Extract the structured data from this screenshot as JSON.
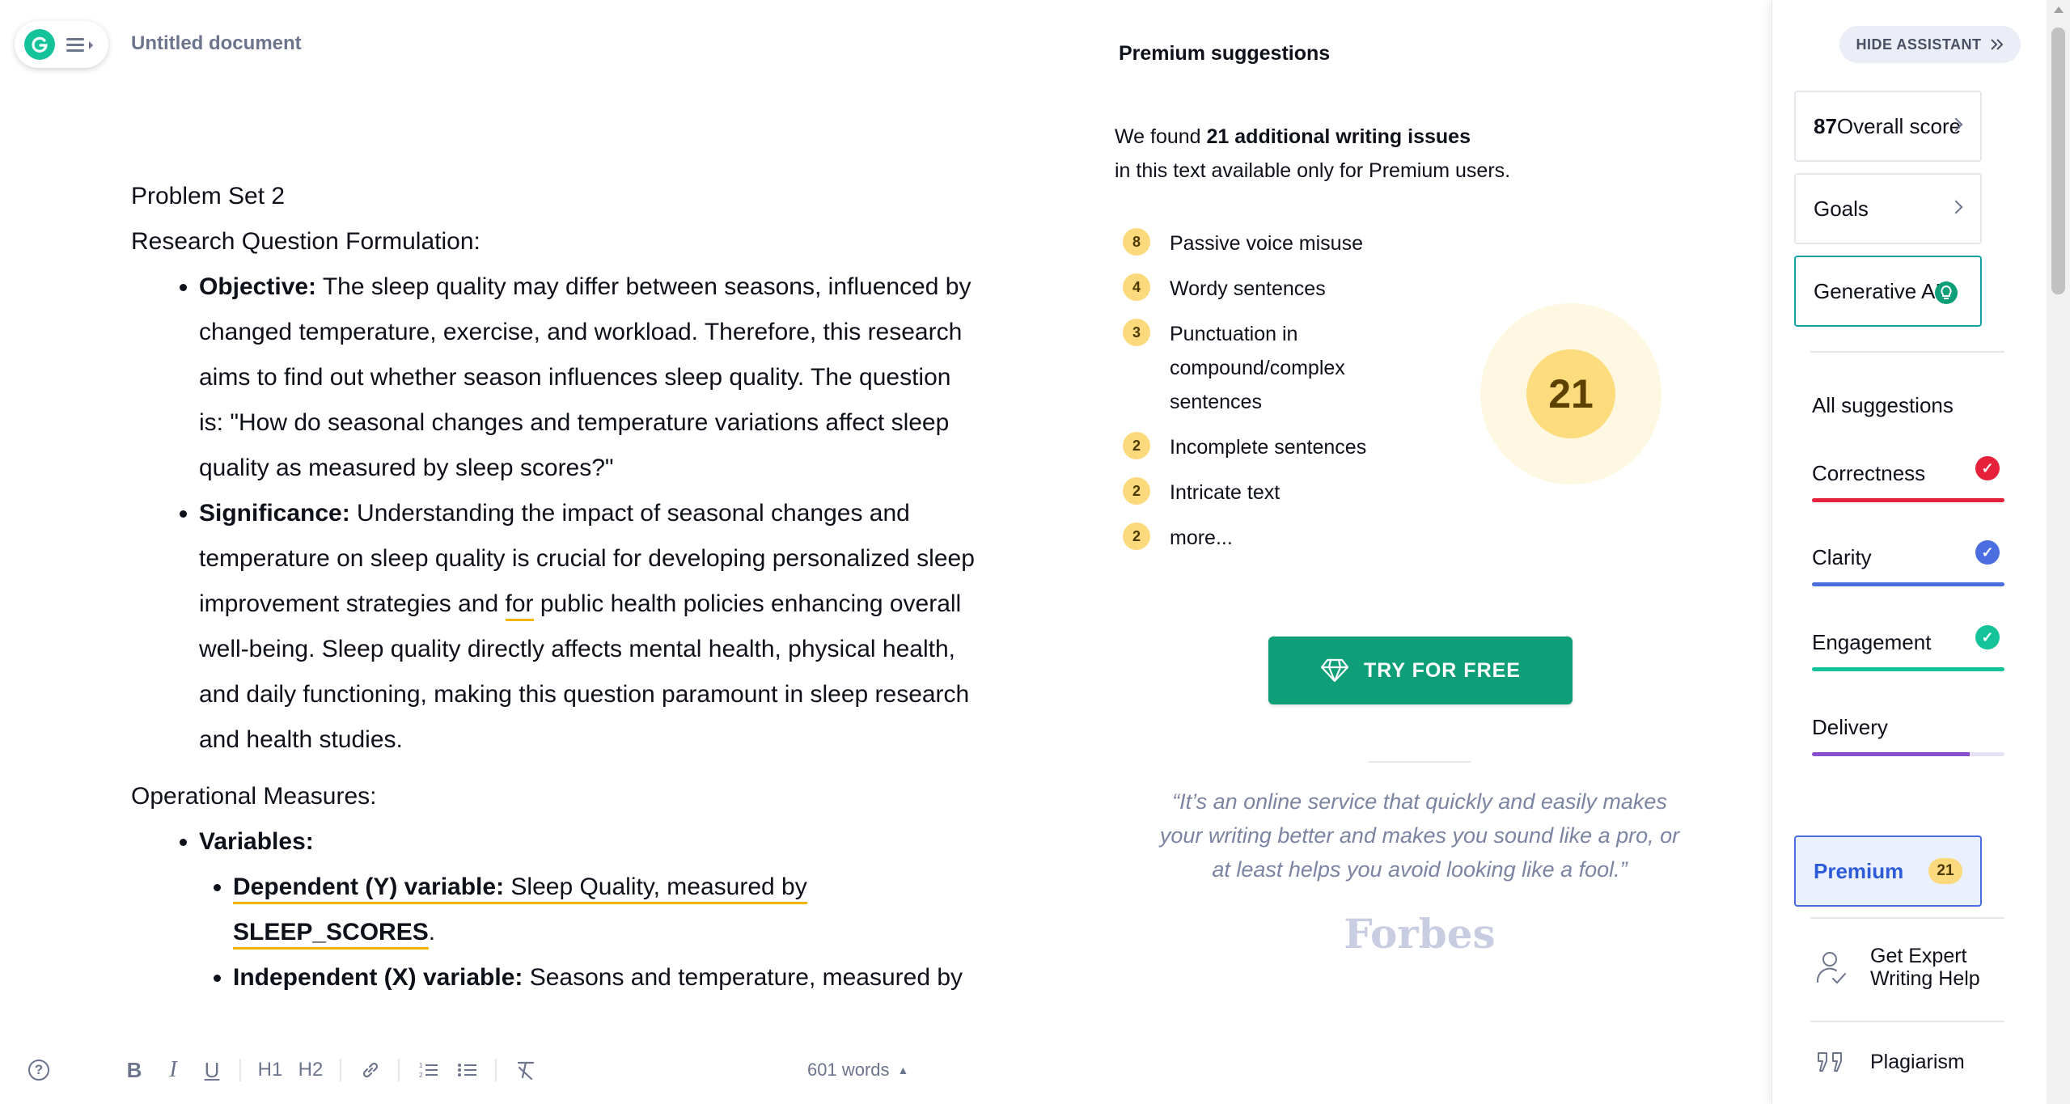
{
  "header": {
    "doc_title": "Untitled document"
  },
  "editor": {
    "line1": "Problem Set 2",
    "line2": "Research Question Formulation:",
    "objective_label": "Objective:",
    "objective_text": " The sleep quality may differ between seasons, influenced by changed temperature, exercise, and workload. Therefore, this research aims to find out whether season influences sleep quality. The question is: \"How do seasonal changes and temperature variations affect sleep quality as measured by sleep scores?\"",
    "significance_label": "Significance:",
    "significance_text_a": " Understanding the impact of seasonal changes and temperature on sleep quality is crucial for developing personalized sleep improvement strategies and ",
    "significance_flagged": "for",
    "significance_text_b": " public health policies enhancing overall well-being. Sleep quality directly affects mental health, physical health, and daily functioning, making this question paramount in sleep research and health studies.",
    "operational": "Operational Measures:",
    "variables_label": "Variables:",
    "dependent_label": "Dependent (Y) variable:",
    "dependent_text": " Sleep Quality, measured by ",
    "dependent_var": "SLEEP_SCORES",
    "dependent_end": ".",
    "independent_label": "Independent (X) variable:",
    "independent_text": " Seasons and temperature, measured by"
  },
  "toolbar": {
    "help": "?",
    "bold": "B",
    "italic": "I",
    "underline": "U",
    "h1": "H1",
    "h2": "H2",
    "word_count": "601 words",
    "word_count_arrow": "▲"
  },
  "premium_panel": {
    "heading": "Premium suggestions",
    "found_prefix": "We found ",
    "found_bold": "21 additional writing issues",
    "found_suffix": "in this text available only for Premium users.",
    "issues": [
      {
        "count": "8",
        "label": "Passive voice misuse"
      },
      {
        "count": "4",
        "label": "Wordy sentences"
      },
      {
        "count": "3",
        "label": "Punctuation in compound/complex sentences"
      },
      {
        "count": "2",
        "label": "Incomplete sentences"
      },
      {
        "count": "2",
        "label": "Intricate text"
      },
      {
        "count": "2",
        "label": "more..."
      }
    ],
    "total_score": "21",
    "cta_label": "TRY FOR FREE",
    "quote": "“It’s an online service that quickly and easily makes your writing better and makes you sound like a pro, or at least helps you avoid looking like a fool.”",
    "quote_source": "Forbes"
  },
  "sidebar": {
    "hide_label": "HIDE ASSISTANT",
    "score_value": "87",
    "score_label": " Overall score",
    "goals_label": "Goals",
    "genai_label": "Generative AI",
    "all_suggestions": "All suggestions",
    "categories": [
      {
        "label": "Correctness",
        "color": "#e5213c",
        "level": 1.0
      },
      {
        "label": "Clarity",
        "color": "#4a6ee0",
        "level": 1.0
      },
      {
        "label": "Engagement",
        "color": "#15c39a",
        "level": 1.0
      },
      {
        "label": "Delivery",
        "color": "#8a4fd0",
        "level": 0.82
      }
    ],
    "premium_label": "Premium",
    "premium_count": "21",
    "expert_label": "Get Expert Writing Help",
    "plagiarism_label": "Plagiarism"
  },
  "colors": {
    "brand_green": "#15c39a",
    "cta_green": "#0e9f79",
    "badge_yellow": "#fcd97d",
    "flag_underline": "#f5b400"
  }
}
